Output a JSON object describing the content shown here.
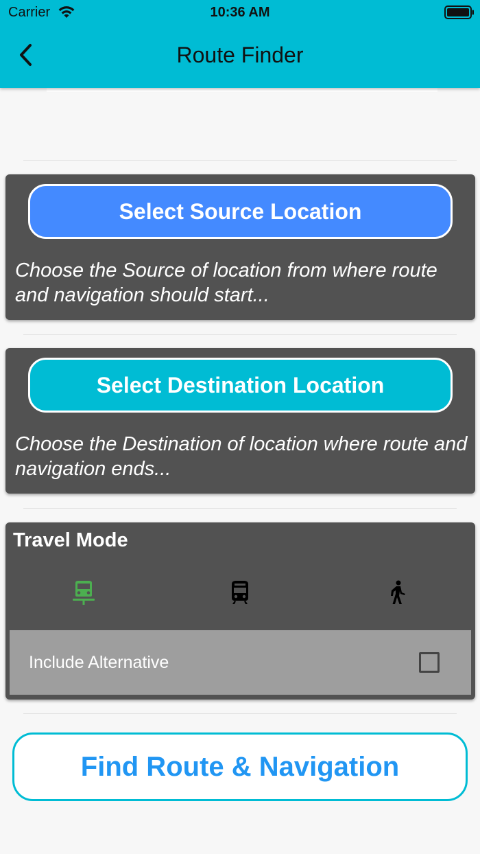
{
  "status_bar": {
    "carrier": "Carrier",
    "time": "10:36 AM"
  },
  "nav": {
    "title": "Route Finder",
    "back_icon": "chevron-left-icon"
  },
  "source_card": {
    "button_label": "Select Source Location",
    "description": "Choose the Source of location from where route and navigation should start...",
    "button_color": "#448aff"
  },
  "destination_card": {
    "button_label": "Select Destination Location",
    "description": "Choose the Destination of location where route and navigation ends...",
    "button_color": "#00bcd4"
  },
  "travel_mode": {
    "title": "Travel Mode",
    "modes": [
      {
        "icon": "car-icon",
        "selected": true,
        "color": "#4caf50"
      },
      {
        "icon": "train-icon",
        "selected": false,
        "color": "#000000"
      },
      {
        "icon": "walk-icon",
        "selected": false,
        "color": "#000000"
      }
    ],
    "include_alternative_label": "Include Alternative",
    "include_alternative_checked": false
  },
  "find_button": {
    "label": "Find Route & Navigation"
  },
  "colors": {
    "header": "#00bcd4",
    "card": "#525252",
    "accent_blue": "#2196f3"
  }
}
